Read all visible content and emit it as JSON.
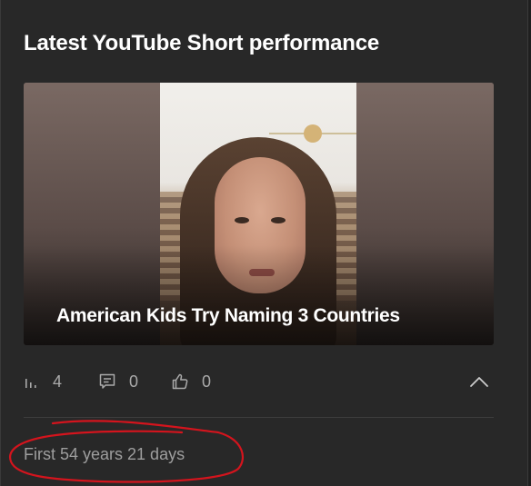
{
  "card": {
    "title": "Latest YouTube Short performance"
  },
  "short": {
    "caption": "American Kids Try Naming 3 Countries"
  },
  "stats": {
    "views_icon": "bar-chart-icon",
    "views": "4",
    "comments_icon": "comment-icon",
    "comments": "0",
    "likes_icon": "thumbs-up-icon",
    "likes": "0",
    "expand_icon": "chevron-up-icon"
  },
  "footer": {
    "text": "First 54 years 21 days"
  },
  "colors": {
    "card_bg": "#282828",
    "text_primary": "#ffffff",
    "text_secondary": "#aaaaaa",
    "annotation": "#d4141d"
  }
}
